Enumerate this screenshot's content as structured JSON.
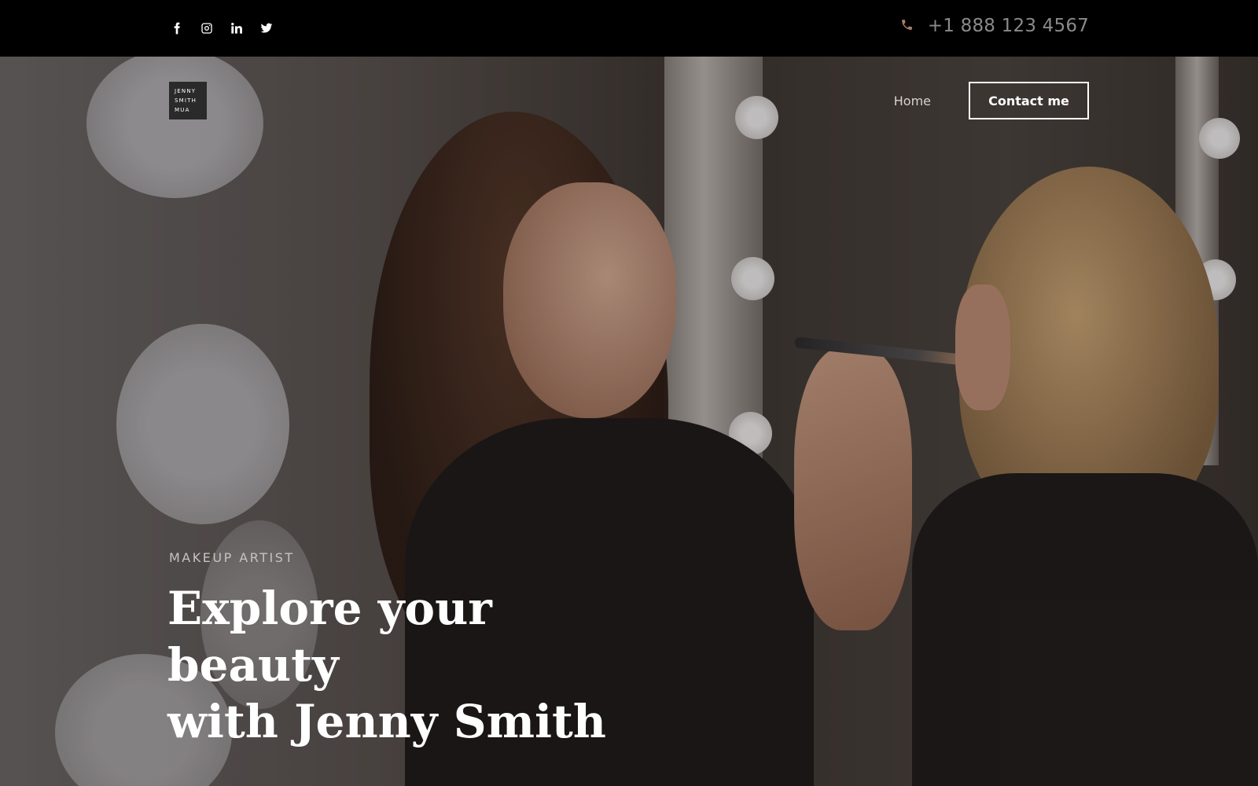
{
  "topbar": {
    "social": [
      {
        "icon": "facebook-icon"
      },
      {
        "icon": "instagram-icon"
      },
      {
        "icon": "linkedin-icon"
      },
      {
        "icon": "twitter-icon"
      }
    ],
    "phone_icon": "phone-icon",
    "phone_number": "+1 888 123 4567"
  },
  "logo": {
    "line1": "JENNY",
    "line2": "SMITH",
    "line3": "MUA"
  },
  "nav": {
    "home_label": "Home",
    "contact_label": "Contact me"
  },
  "hero": {
    "eyebrow": "MAKEUP ARTIST",
    "headline_line1": "Explore your beauty",
    "headline_line2": "with Jenny Smith"
  },
  "colors": {
    "topbar_bg": "#000000",
    "phone_icon": "#a87f68",
    "text_primary": "#ffffff"
  }
}
